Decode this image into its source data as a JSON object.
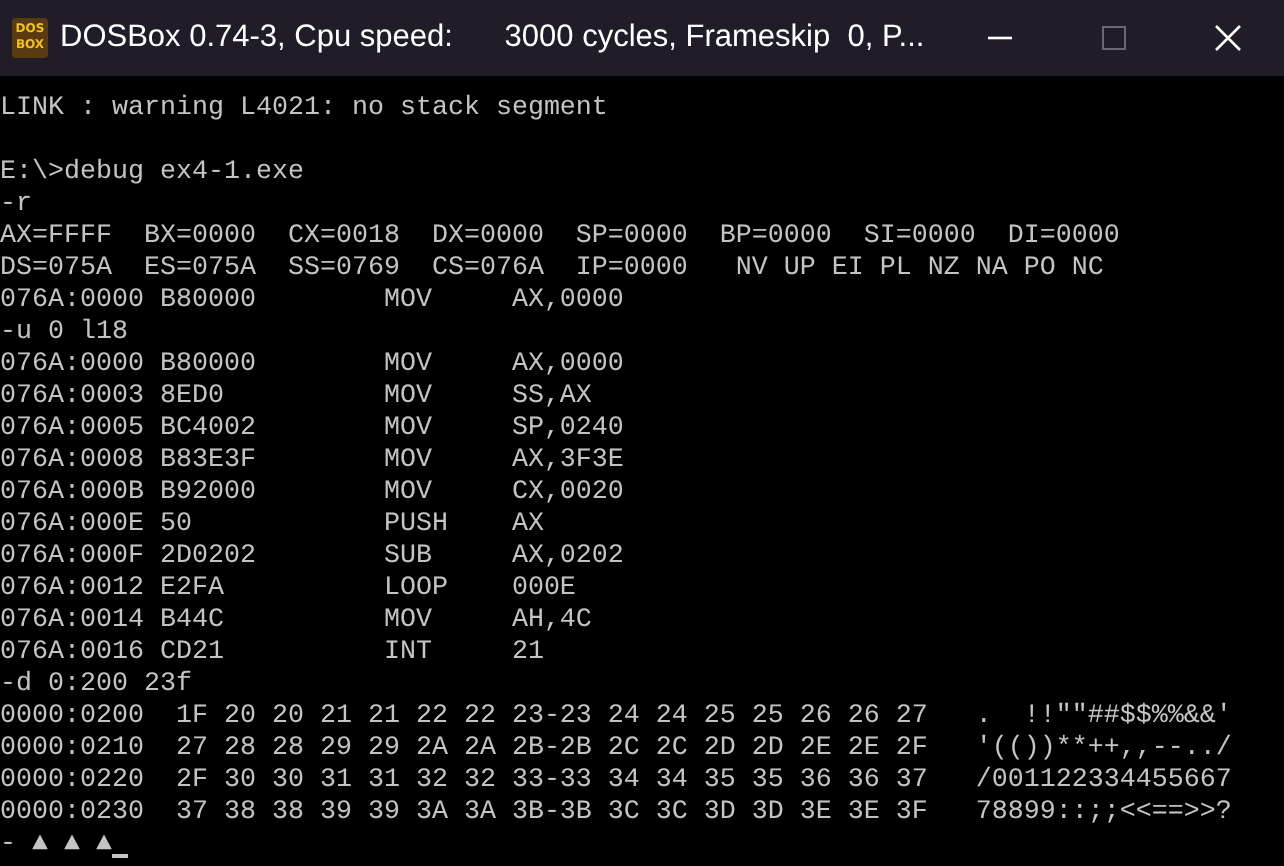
{
  "window": {
    "title": "DOSBox 0.74-3, Cpu speed:      3000 cycles, Frameskip  0, P...",
    "logo_text": [
      "DOS",
      "BOX"
    ]
  },
  "terminal": {
    "lines": [
      {
        "kind": "text",
        "text": "LINK : warning L4021: no stack segment"
      },
      {
        "kind": "blank"
      },
      {
        "kind": "text",
        "text": "E:\\>debug ex4-1.exe"
      },
      {
        "kind": "text",
        "text": "-r"
      },
      {
        "kind": "text",
        "text": "AX=FFFF  BX=0000  CX=0018  DX=0000  SP=0000  BP=0000  SI=0000  DI=0000"
      },
      {
        "kind": "text",
        "text": "DS=075A  ES=075A  SS=0769  CS=076A  IP=0000   NV UP EI PL NZ NA PO NC"
      },
      {
        "kind": "text",
        "text": "076A:0000 B80000        MOV     AX,0000"
      },
      {
        "kind": "text",
        "text": "-u 0 l18"
      },
      {
        "kind": "text",
        "text": "076A:0000 B80000        MOV     AX,0000"
      },
      {
        "kind": "text",
        "text": "076A:0003 8ED0          MOV     SS,AX"
      },
      {
        "kind": "text",
        "text": "076A:0005 BC4002        MOV     SP,0240"
      },
      {
        "kind": "text",
        "text": "076A:0008 B83E3F        MOV     AX,3F3E"
      },
      {
        "kind": "text",
        "text": "076A:000B B92000        MOV     CX,0020"
      },
      {
        "kind": "text",
        "text": "076A:000E 50            PUSH    AX"
      },
      {
        "kind": "text",
        "text": "076A:000F 2D0202        SUB     AX,0202"
      },
      {
        "kind": "text",
        "text": "076A:0012 E2FA          LOOP    000E"
      },
      {
        "kind": "text",
        "text": "076A:0014 B44C          MOV     AH,4C"
      },
      {
        "kind": "text",
        "text": "076A:0016 CD21          INT     21"
      },
      {
        "kind": "text",
        "text": "-d 0:200 23f"
      },
      {
        "kind": "text",
        "text": "0000:0200  1F 20 20 21 21 22 22 23-23 24 24 25 25 26 26 27   .  !!\"\"##$$%%&&'"
      },
      {
        "kind": "text",
        "text": "0000:0210  27 28 28 29 29 2A 2A 2B-2B 2C 2C 2D 2D 2E 2E 2F   '(())**++,,--../"
      },
      {
        "kind": "text",
        "text": "0000:0220  2F 30 30 31 31 32 32 33-33 34 34 35 35 36 36 37   /001122334455667"
      },
      {
        "kind": "text",
        "text": "0000:0230  37 38 38 39 39 3A 3A 3B-3B 3C 3C 3D 3D 3E 3E 3F   78899::;;<<==>>?"
      },
      {
        "kind": "prompt",
        "text": "- ▲ ▲ ▲"
      }
    ]
  }
}
